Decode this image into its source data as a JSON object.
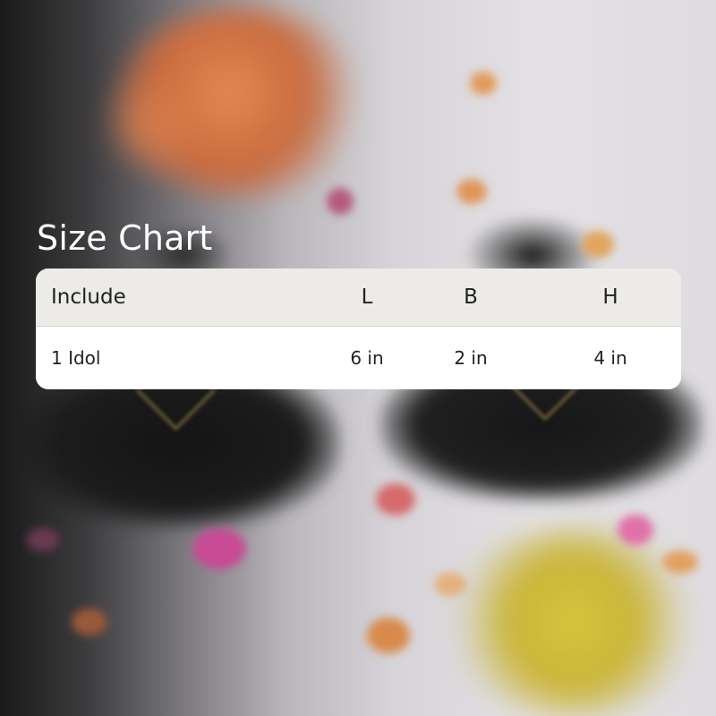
{
  "title": "Size Chart",
  "table": {
    "columns": [
      "Include",
      "L",
      "B",
      "H"
    ],
    "rows": [
      [
        "1 Idol",
        "6 in",
        "2 in",
        "4 in"
      ]
    ]
  }
}
